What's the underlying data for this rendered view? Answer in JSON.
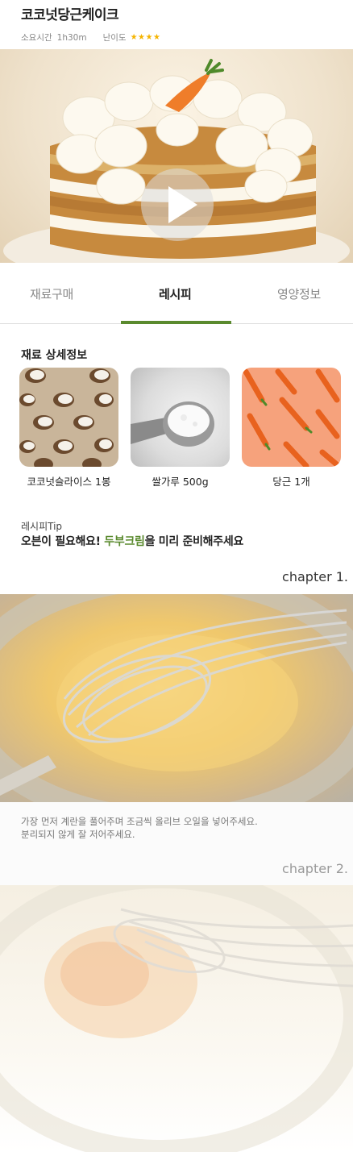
{
  "recipe": {
    "title": "코코넛당근케이크",
    "time_label": "소요시간",
    "time_value": "1h30m",
    "difficulty_label": "난이도",
    "difficulty_stars": "★★★★",
    "difficulty_rating": 4
  },
  "tabs": [
    {
      "label": "재료구매",
      "active": false
    },
    {
      "label": "레시피",
      "active": true
    },
    {
      "label": "영양정보",
      "active": false
    }
  ],
  "ingredients": {
    "title": "재료 상세정보",
    "items": [
      {
        "label": "코코넛슬라이스 1봉",
        "icon": "coconut-image"
      },
      {
        "label": "쌀가루 500g",
        "icon": "rice-flour-image"
      },
      {
        "label": "당근 1개",
        "icon": "carrot-image"
      }
    ]
  },
  "tip": {
    "label": "레시피Tip",
    "text_before": "오븐이 필요해요! ",
    "highlight": "두부크림",
    "text_after": "을 미리 준비해주세요"
  },
  "chapters": [
    {
      "label": "chapter 1.",
      "description_line1": "가장 먼저 계란을 풀어주며 조금씩 올리브 오일을 넣어주세요.",
      "description_line2": "분리되지 않게 잘 저어주세요."
    },
    {
      "label": "chapter 2."
    }
  ],
  "colors": {
    "accent_green": "#5a8a2e",
    "star": "#f5b400",
    "carrot_bg": "#f6a27c"
  }
}
